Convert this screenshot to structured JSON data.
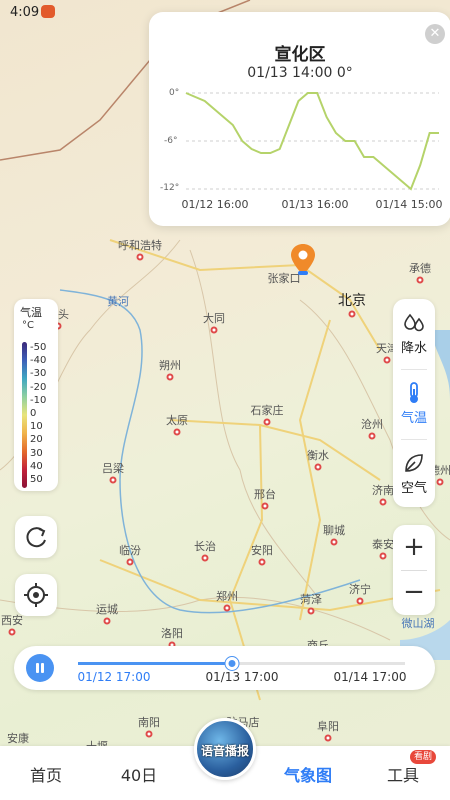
{
  "status_bar": {
    "time": "4:09"
  },
  "popup": {
    "location": "宣化区",
    "reading": "01/13 14:00 0°",
    "close_icon": "close-icon",
    "y_ticks": [
      "0°",
      "-6°",
      "-12°"
    ],
    "x_ticks": [
      "01/12 16:00",
      "01/13 16:00",
      "01/14 15:00"
    ]
  },
  "chart_data": {
    "type": "line",
    "x_labels_shown": [
      "01/12 16:00",
      "01/13 16:00",
      "01/14 15:00"
    ],
    "ylim": [
      -12,
      0
    ],
    "series": [
      {
        "values": [
          0,
          -0.5,
          -1,
          -2,
          -3,
          -4,
          -6,
          -7,
          -7.5,
          -7.5,
          -7,
          -4,
          -1,
          0,
          0,
          -3,
          -5,
          -6,
          -6,
          -8,
          -8,
          -9,
          -10,
          -11,
          -12,
          -9,
          -5,
          -5
        ]
      }
    ]
  },
  "legend": {
    "title": "气温",
    "unit": "°C",
    "ticks": [
      "-50",
      "-40",
      "-30",
      "-20",
      "-10",
      "0",
      "10",
      "20",
      "30",
      "40",
      "50"
    ]
  },
  "layers": [
    {
      "label": "降水",
      "icon": "raindrop-icon",
      "active": false
    },
    {
      "label": "气温",
      "icon": "thermometer-icon",
      "active": true
    },
    {
      "label": "空气",
      "icon": "leaf-icon",
      "active": false
    }
  ],
  "zoom": {
    "in": "+",
    "out": "−"
  },
  "timeline": {
    "labels": [
      "01/12 17:00",
      "01/13 17:00",
      "01/14 17:00"
    ],
    "current_label": "01/13 17:00",
    "progress": 0.47
  },
  "nav": {
    "items": [
      "首页",
      "40日",
      "气象图",
      "工具"
    ],
    "active": "气象图",
    "badge": "看剧",
    "voice_label": "语音播报"
  },
  "map": {
    "pin_label": "张家口",
    "cities": [
      {
        "name": "呼和浩特",
        "big": false
      },
      {
        "name": "北京",
        "big": true
      },
      {
        "name": "太原",
        "big": false
      },
      {
        "name": "石家庄",
        "big": false
      },
      {
        "name": "济南",
        "big": false
      },
      {
        "name": "郑州",
        "big": false
      },
      {
        "name": "天津",
        "big": false
      },
      {
        "name": "西安",
        "big": false
      },
      {
        "name": "包头",
        "big": false
      },
      {
        "name": "大同",
        "big": false
      },
      {
        "name": "朔州",
        "big": false
      },
      {
        "name": "承德",
        "big": false
      },
      {
        "name": "沧州",
        "big": false
      },
      {
        "name": "衡水",
        "big": false
      },
      {
        "name": "邢台",
        "big": false
      },
      {
        "name": "吕梁",
        "big": false
      },
      {
        "name": "临汾",
        "big": false
      },
      {
        "name": "长治",
        "big": false
      },
      {
        "name": "安阳",
        "big": false
      },
      {
        "name": "聊城",
        "big": false
      },
      {
        "name": "泰安",
        "big": false
      },
      {
        "name": "运城",
        "big": false
      },
      {
        "name": "洛阳",
        "big": false
      },
      {
        "name": "菏泽",
        "big": false
      },
      {
        "name": "济宁",
        "big": false
      },
      {
        "name": "商丘",
        "big": false
      },
      {
        "name": "南阳",
        "big": false
      },
      {
        "name": "驻马店",
        "big": false
      },
      {
        "name": "阜阳",
        "big": false
      },
      {
        "name": "安康",
        "big": false
      },
      {
        "name": "十堰",
        "big": false
      },
      {
        "name": "德州",
        "big": false
      },
      {
        "name": "微山湖",
        "big": false
      },
      {
        "name": "黄河",
        "big": false
      }
    ]
  }
}
